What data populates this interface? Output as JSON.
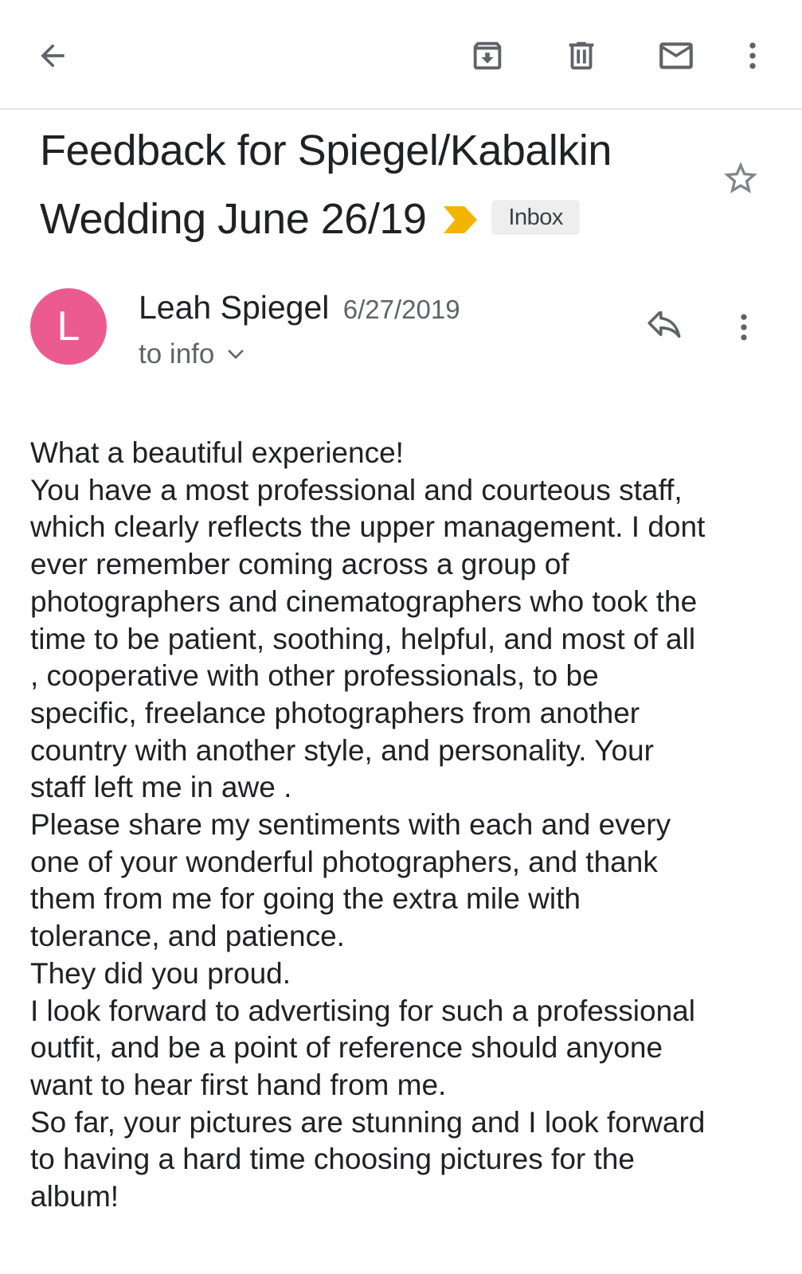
{
  "toolbar": {
    "icons": [
      "arrow-back-icon",
      "archive-icon",
      "trash-icon",
      "mail-unread-icon",
      "more-vert-icon"
    ]
  },
  "email": {
    "subject_line1": "Feedback for Spiegel/Kabalkin",
    "subject_line2": "Wedding June 26/19",
    "label": "Inbox",
    "importance_color": "#f4b400",
    "sender": {
      "initial": "L",
      "name": "Leah Spiegel",
      "date": "6/27/2019",
      "avatar_color": "#ec5b8f"
    },
    "recipient": "to info",
    "body_lines": [
      "What a beautiful experience!",
      "You have a most professional and courteous staff,",
      "which clearly reflects the upper management. I dont",
      "ever remember coming across a group of",
      "photographers and cinematographers who took the",
      "time to be patient, soothing, helpful, and most of all",
      ", cooperative with other professionals,  to be",
      "specific, freelance photographers from another",
      "country with another style, and personality. Your",
      "staff left me in awe .",
      "Please share my sentiments with each and every",
      "one of your wonderful photographers, and thank",
      "them from me for going the extra mile with",
      "tolerance, and patience.",
      "They did you proud.",
      "I look forward to advertising for such a professional",
      "outfit, and be a point of reference should anyone",
      "want to hear first hand from me.",
      "So far, your pictures are stunning and I look forward",
      "to having a hard time choosing pictures for the",
      "album!"
    ]
  }
}
